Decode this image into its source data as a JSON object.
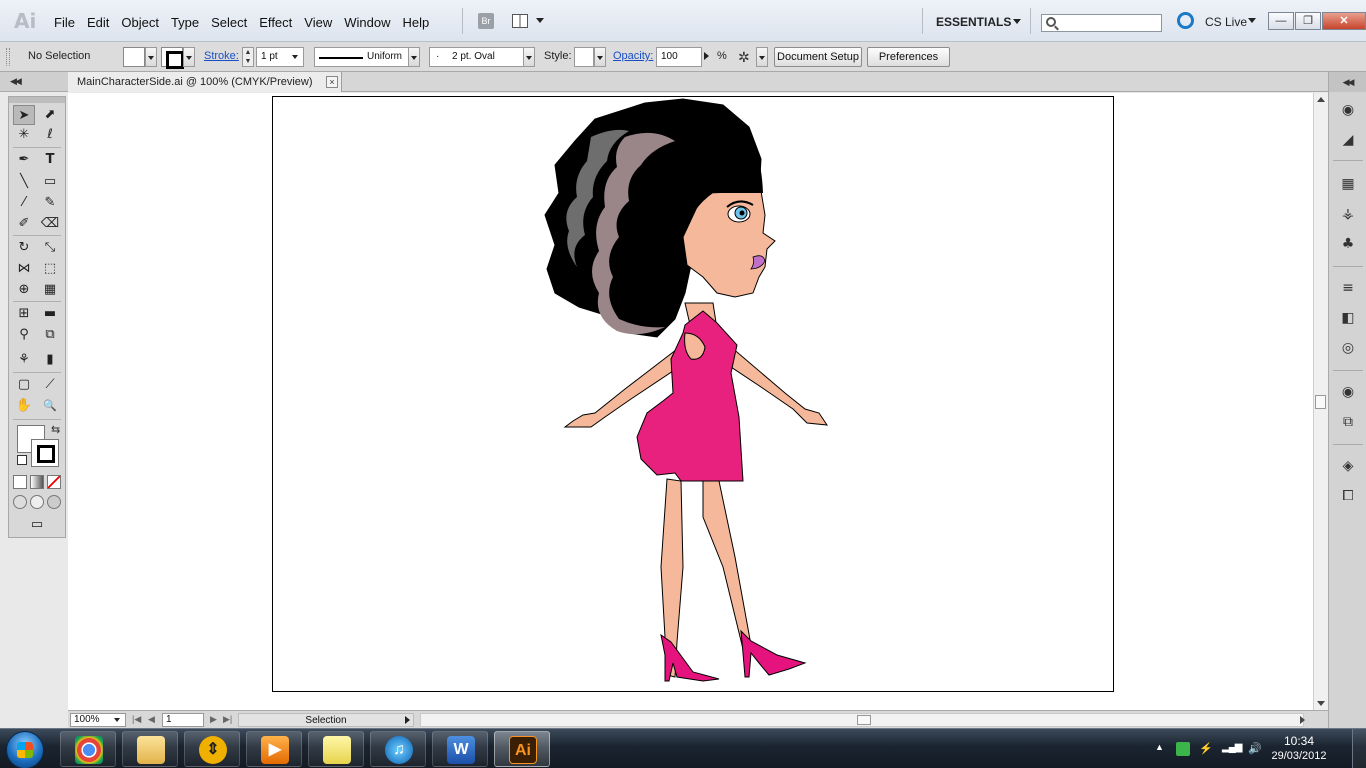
{
  "app": {
    "logo": "Ai",
    "menu": [
      "File",
      "Edit",
      "Object",
      "Type",
      "Select",
      "Effect",
      "View",
      "Window",
      "Help"
    ],
    "bridge_label": "Br",
    "workspace": "ESSENTIALS",
    "search_placeholder": "",
    "cs_live": "CS Live",
    "window_buttons": {
      "minimize": "—",
      "maximize": "❐",
      "close": "✕"
    }
  },
  "control_bar": {
    "selection_state": "No Selection",
    "stroke_label": "Stroke:",
    "stroke_weight": "1 pt",
    "stroke_profile": "Uniform",
    "brush": "2 pt. Oval",
    "brush_dot": "·",
    "style_label": "Style:",
    "opacity_label": "Opacity:",
    "opacity_value": "100",
    "opacity_unit": "%",
    "document_setup": "Document Setup",
    "preferences": "Preferences"
  },
  "document": {
    "tab_title": "MainCharacterSide.ai @ 100% (CMYK/Preview)",
    "close_glyph": "×"
  },
  "status_bar": {
    "zoom": "100%",
    "page": "1",
    "tool_status": "Selection",
    "nav_first": "|◀",
    "nav_prev": "◀",
    "nav_next": "▶",
    "nav_last": "▶|"
  },
  "tools": [
    "selection-tool",
    "direct-selection-tool",
    "magic-wand-tool",
    "lasso-tool",
    "pen-tool",
    "type-tool",
    "line-segment-tool",
    "rectangle-tool",
    "paintbrush-tool",
    "pencil-tool",
    "blob-brush-tool",
    "eraser-tool",
    "rotate-tool",
    "scale-tool",
    "width-tool",
    "free-transform-tool",
    "shape-builder-tool",
    "perspective-grid-tool",
    "mesh-tool",
    "gradient-tool",
    "eyedropper-tool",
    "blend-tool",
    "symbol-sprayer-tool",
    "column-graph-tool",
    "artboard-tool",
    "slice-tool",
    "hand-tool",
    "zoom-tool"
  ],
  "tool_glyphs": {
    "selection": "➤",
    "direct_selection": "⬈",
    "magic_wand": "✳",
    "lasso": "ℓ",
    "pen": "✒",
    "type": "T",
    "line": "╲",
    "rectangle": "▭",
    "brush": "⁄",
    "pencil": "✎",
    "blob": "✐",
    "eraser": "⌫",
    "rotate": "↻",
    "scale": "⤡",
    "width": "⋈",
    "free_transform": "⬚",
    "shape_builder": "⊕",
    "perspective": "▦",
    "mesh": "⊞",
    "gradient": "▬",
    "eyedropper": "⚲",
    "blend": "⧉",
    "symbol_sprayer": "⚘",
    "graph": "▮",
    "artboard": "▢",
    "slice": "⟋",
    "hand": "✋",
    "zoom": "🔍",
    "swap": "⇆",
    "screen_mode": "▭"
  },
  "right_panel_icons": [
    "color-icon",
    "color-guide-icon",
    "swatches-icon",
    "brushes-icon",
    "symbols-icon",
    "stroke-icon",
    "gradient-icon",
    "transparency-icon",
    "appearance-icon",
    "graphic-styles-icon",
    "layers-icon",
    "artboards-icon"
  ],
  "right_panel_glyphs": [
    "◉",
    "◢",
    "▦",
    "⚶",
    "♣",
    "≡",
    "◧",
    "◎",
    "◉",
    "⧉",
    "◈",
    "⧠"
  ],
  "taskbar": {
    "apps": [
      "chrome-icon",
      "explorer-icon",
      "download-icon",
      "media-icon",
      "sticky-notes-icon",
      "itunes-icon",
      "word-icon",
      "illustrator-icon"
    ],
    "app_glyphs": [
      "◉",
      "▤",
      "⇕",
      "▶",
      "▭",
      "♫",
      "W",
      "Ai"
    ],
    "clock_time": "10:34",
    "clock_date": "29/03/2012",
    "tray_show_hidden": "▲"
  },
  "colors": {
    "dress": "#e8207e",
    "skin": "#f5b89a",
    "hair": "#000000",
    "hair_highlight_1": "#6e6e6e",
    "hair_highlight_2": "#9a8588",
    "lips": "#c070c8",
    "eye": "#6ec4e8",
    "shoes": "#e5137d",
    "ai_orange": "#f7931e"
  }
}
